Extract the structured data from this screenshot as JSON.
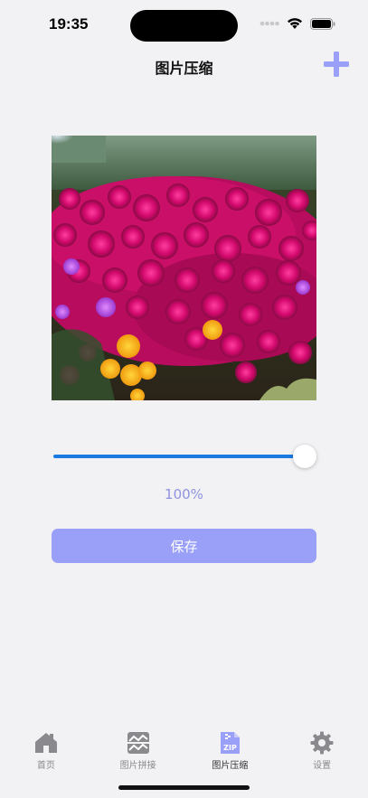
{
  "status_bar": {
    "time": "19:35"
  },
  "nav": {
    "title": "图片压缩",
    "add_icon": "plus-icon"
  },
  "compression": {
    "quality_percent": 100,
    "percent_label": "100%",
    "save_label": "保存"
  },
  "tabs": [
    {
      "label": "首页",
      "icon": "home-icon",
      "active": false
    },
    {
      "label": "图片拼接",
      "icon": "image-stitch-icon",
      "active": false
    },
    {
      "label": "图片压缩",
      "icon": "zip-icon",
      "active": true
    },
    {
      "label": "设置",
      "icon": "gear-icon",
      "active": false
    }
  ],
  "colors": {
    "accent": "#9aa0f8",
    "slider": "#1a7ae0",
    "percent_text": "#8e93e0",
    "background": "#f2f2f4"
  }
}
